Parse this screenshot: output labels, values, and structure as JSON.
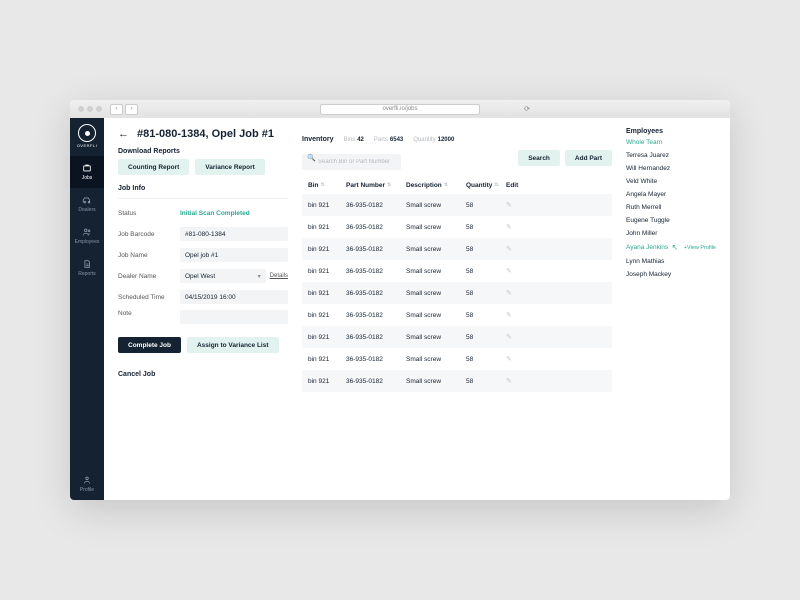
{
  "browser": {
    "url": "overfli.io/jobs"
  },
  "sidebar": {
    "brand": "OVERFLI",
    "items": [
      {
        "label": "Jobs",
        "active": true
      },
      {
        "label": "Dealers"
      },
      {
        "label": "Employees"
      },
      {
        "label": "Reports"
      }
    ],
    "profile": "Profile"
  },
  "page": {
    "title": "#81-080-1384, Opel Job #1",
    "download_label": "Download Reports",
    "counting_btn": "Counting Report",
    "variance_btn": "Variance Report",
    "jobinfo_label": "Job Info",
    "status_label": "Status",
    "status_value": "Initial Scan Completed",
    "barcode_label": "Job Barcode",
    "barcode_value": "#81-080-1384",
    "name_label": "Job Name",
    "name_value": "Opel job #1",
    "dealer_label": "Dealer Name",
    "dealer_value": "Opel West",
    "details_link": "Details",
    "sched_label": "Scheduled Time",
    "sched_value": "04/15/2019 16:00",
    "note_label": "Note",
    "complete_btn": "Complete Job",
    "assign_btn": "Assign to Variance List",
    "cancel_link": "Cancel Job"
  },
  "inventory": {
    "title": "Inventory",
    "bins_label": "Bins",
    "bins_value": "42",
    "parts_label": "Parts",
    "parts_value": "6543",
    "qty_label": "Quantity",
    "qty_value": "12000",
    "search_placeholder": "Search Bin or Part Number",
    "search_btn": "Search",
    "add_btn": "Add Part",
    "headers": {
      "bin": "Bin",
      "part": "Part Number",
      "desc": "Description",
      "qty": "Quantity",
      "edit": "Edit"
    },
    "rows": [
      {
        "bin": "bin 921",
        "part": "36-935-0182",
        "desc": "Small screw",
        "qty": "58"
      },
      {
        "bin": "bin 921",
        "part": "36-935-0182",
        "desc": "Small screw",
        "qty": "58"
      },
      {
        "bin": "bin 921",
        "part": "36-935-0182",
        "desc": "Small screw",
        "qty": "58"
      },
      {
        "bin": "bin 921",
        "part": "36-935-0182",
        "desc": "Small screw",
        "qty": "58"
      },
      {
        "bin": "bin 921",
        "part": "36-935-0182",
        "desc": "Small screw",
        "qty": "58"
      },
      {
        "bin": "bin 921",
        "part": "36-935-0182",
        "desc": "Small screw",
        "qty": "58"
      },
      {
        "bin": "bin 921",
        "part": "36-935-0182",
        "desc": "Small screw",
        "qty": "58"
      },
      {
        "bin": "bin 921",
        "part": "36-935-0182",
        "desc": "Small screw",
        "qty": "58"
      },
      {
        "bin": "bin 921",
        "part": "36-935-0182",
        "desc": "Small screw",
        "qty": "58"
      }
    ]
  },
  "employees": {
    "title": "Employees",
    "whole_team": "Whole Team",
    "view_profile": "+View Profile",
    "list": [
      "Terresa Juarez",
      "Will Hernandez",
      "Veld White",
      "Angela Mayer",
      "Ruth Merrell",
      "Eugene Tuggle",
      "John Miller",
      "Ayana Jenkins",
      "Lynn Mathias",
      "Joseph Mackey"
    ]
  }
}
